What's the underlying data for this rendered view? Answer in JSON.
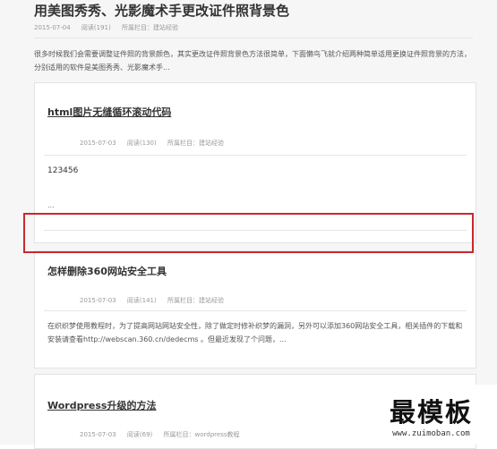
{
  "top_article": {
    "title": "用美图秀秀、光影魔术手更改证件照背景色",
    "date": "2015-07-04",
    "views": "阅读(191)",
    "category": "所属栏目：建站经验",
    "summary": "很多时候我们会需要调整证件照的背景颜色，其实更改证件照背景色方法很简单，下面懒鸟飞就介绍两种简单适用更换证件照背景的方法，分别适用的软件是美图秀秀、光影魔术手..."
  },
  "article_1": {
    "title": "html图片无缝循环滚动代码",
    "date": "2015-07-03",
    "views": "阅读(130)",
    "category": "所属栏目：建站经验",
    "content": "123456",
    "ellipsis": "..."
  },
  "article_2": {
    "title": "怎样删除360网站安全工具",
    "date": "2015-07-03",
    "views": "阅读(141)",
    "category": "所属栏目：建站经验",
    "summary": "在织织梦使用教程时，为了提高网站网站安全性，除了做定时修补织梦的漏洞，另外可以添加360网站安全工具，相关插件的下载和安装请查看http://webscan.360.cn/dedecms 。但最近发现了个问题，..."
  },
  "article_3": {
    "title": "Wordpress升级的方法",
    "date": "2015-07-03",
    "views": "阅读(69)",
    "category": "所属栏目：wordpress教程"
  },
  "watermark": {
    "name": "最模板",
    "url": "www.zuimoban.com"
  },
  "colors": {
    "highlight_border": "#c8282e"
  }
}
